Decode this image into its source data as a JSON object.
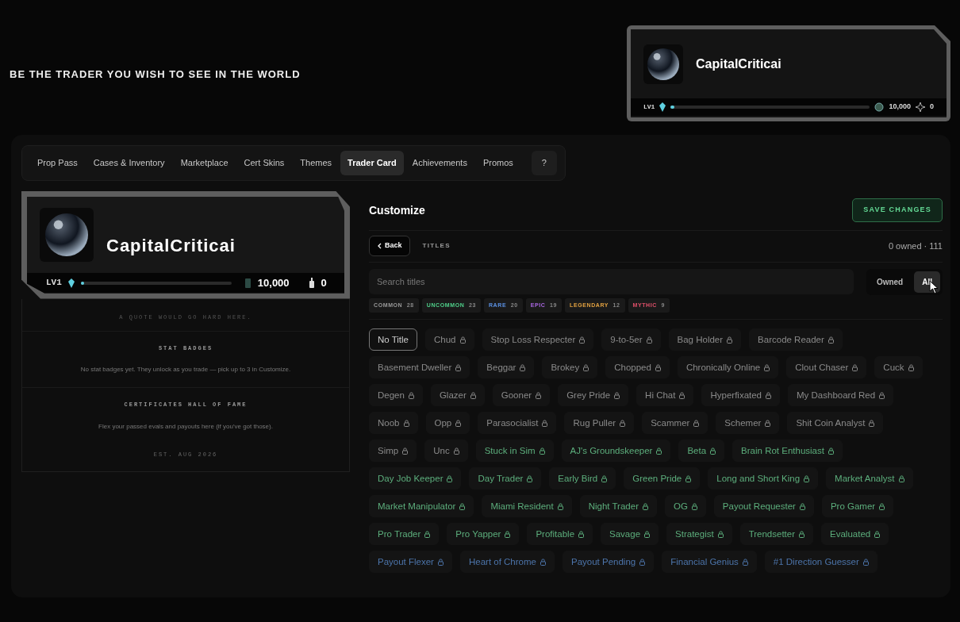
{
  "tagline": "BE THE TRADER YOU WISH TO SEE IN THE WORLD",
  "mini_card": {
    "username": "CapitalCriticai",
    "level_label": "LV1",
    "level": 0.02,
    "coins": "10,000",
    "stars": "0"
  },
  "tabs": [
    {
      "label": "Prop Pass",
      "selected": false
    },
    {
      "label": "Cases & Inventory",
      "selected": false
    },
    {
      "label": "Marketplace",
      "selected": false
    },
    {
      "label": "Cert Skins",
      "selected": false
    },
    {
      "label": "Themes",
      "selected": false
    },
    {
      "label": "Trader Card",
      "selected": true
    },
    {
      "label": "Achievements",
      "selected": false
    },
    {
      "label": "Promos",
      "selected": false
    },
    {
      "label": "?",
      "selected": false
    }
  ],
  "trader_card": {
    "username": "CapitalCriticai",
    "level_label": "LV1",
    "level": 0.02,
    "coins": "10,000",
    "badges": "0",
    "quote": "A QUOTE WOULD GO HARD HERE.",
    "stat_badges_heading": "STAT BADGES",
    "stat_badges_text": "No stat badges yet. They unlock as you trade — pick up to 3 in Customize.",
    "certificates_heading": "CERTIFICATES HALL OF FAME",
    "certificates_text": "Flex your passed evals and payouts here (if you've got those).",
    "established": "EST. AUG 2026"
  },
  "customize": {
    "title": "Customize",
    "save_button": "SAVE CHANGES",
    "back_button": "Back",
    "section": "TITLES",
    "count": "0 owned · 111",
    "search": {
      "placeholder": "Search titles"
    },
    "filter": [
      {
        "label": "Owned",
        "selected": false
      },
      {
        "label": "All",
        "selected": true
      }
    ],
    "rarities": [
      {
        "label": "COMMON",
        "count": "28",
        "color": "#9a9a9a"
      },
      {
        "label": "UNCOMMON",
        "count": "23",
        "color": "#4fd08a"
      },
      {
        "label": "RARE",
        "count": "20",
        "color": "#5a8fe0"
      },
      {
        "label": "EPIC",
        "count": "19",
        "color": "#a865e0"
      },
      {
        "label": "LEGENDARY",
        "count": "12",
        "color": "#e0a040"
      },
      {
        "label": "MYTHIC",
        "count": "9",
        "color": "#e0506a"
      }
    ],
    "titles": [
      {
        "label": "No Title",
        "kind": "none",
        "locked": false,
        "selected": true
      },
      {
        "label": "Chud",
        "kind": "common",
        "locked": true,
        "selected": false
      },
      {
        "label": "Stop Loss Respecter",
        "kind": "common",
        "locked": true,
        "selected": false
      },
      {
        "label": "9-to-5er",
        "kind": "common",
        "locked": true,
        "selected": false
      },
      {
        "label": "Bag Holder",
        "kind": "common",
        "locked": true,
        "selected": false
      },
      {
        "label": "Barcode Reader",
        "kind": "common",
        "locked": true,
        "selected": false
      },
      {
        "label": "Basement Dweller",
        "kind": "common",
        "locked": true,
        "selected": false
      },
      {
        "label": "Beggar",
        "kind": "common",
        "locked": true,
        "selected": false
      },
      {
        "label": "Brokey",
        "kind": "common",
        "locked": true,
        "selected": false
      },
      {
        "label": "Chopped",
        "kind": "common",
        "locked": true,
        "selected": false
      },
      {
        "label": "Chronically Online",
        "kind": "common",
        "locked": true,
        "selected": false
      },
      {
        "label": "Clout Chaser",
        "kind": "common",
        "locked": true,
        "selected": false
      },
      {
        "label": "Cuck",
        "kind": "common",
        "locked": true,
        "selected": false
      },
      {
        "label": "Degen",
        "kind": "common",
        "locked": true,
        "selected": false
      },
      {
        "label": "Glazer",
        "kind": "common",
        "locked": true,
        "selected": false
      },
      {
        "label": "Gooner",
        "kind": "common",
        "locked": true,
        "selected": false
      },
      {
        "label": "Grey Pride",
        "kind": "common",
        "locked": true,
        "selected": false
      },
      {
        "label": "Hi Chat",
        "kind": "common",
        "locked": true,
        "selected": false
      },
      {
        "label": "Hyperfixated",
        "kind": "common",
        "locked": true,
        "selected": false
      },
      {
        "label": "My Dashboard Red",
        "kind": "common",
        "locked": true,
        "selected": false
      },
      {
        "label": "Noob",
        "kind": "common",
        "locked": true,
        "selected": false
      },
      {
        "label": "Opp",
        "kind": "common",
        "locked": true,
        "selected": false
      },
      {
        "label": "Parasocialist",
        "kind": "common",
        "locked": true,
        "selected": false
      },
      {
        "label": "Rug Puller",
        "kind": "common",
        "locked": true,
        "selected": false
      },
      {
        "label": "Scammer",
        "kind": "common",
        "locked": true,
        "selected": false
      },
      {
        "label": "Schemer",
        "kind": "common",
        "locked": true,
        "selected": false
      },
      {
        "label": "Shit Coin Analyst",
        "kind": "common",
        "locked": true,
        "selected": false
      },
      {
        "label": "Simp",
        "kind": "common",
        "locked": true,
        "selected": false
      },
      {
        "label": "Unc",
        "kind": "common",
        "locked": true,
        "selected": false
      },
      {
        "label": "Stuck in Sim",
        "kind": "uncommon",
        "locked": true,
        "selected": false
      },
      {
        "label": "AJ's Groundskeeper",
        "kind": "uncommon",
        "locked": true,
        "selected": false
      },
      {
        "label": "Beta",
        "kind": "uncommon",
        "locked": true,
        "selected": false
      },
      {
        "label": "Brain Rot Enthusiast",
        "kind": "uncommon",
        "locked": true,
        "selected": false
      },
      {
        "label": "Day Job Keeper",
        "kind": "uncommon",
        "locked": true,
        "selected": false
      },
      {
        "label": "Day Trader",
        "kind": "uncommon",
        "locked": true,
        "selected": false
      },
      {
        "label": "Early Bird",
        "kind": "uncommon",
        "locked": true,
        "selected": false
      },
      {
        "label": "Green Pride",
        "kind": "uncommon",
        "locked": true,
        "selected": false
      },
      {
        "label": "Long and Short King",
        "kind": "uncommon",
        "locked": true,
        "selected": false
      },
      {
        "label": "Market Analyst",
        "kind": "uncommon",
        "locked": true,
        "selected": false
      },
      {
        "label": "Market Manipulator",
        "kind": "uncommon",
        "locked": true,
        "selected": false
      },
      {
        "label": "Miami Resident",
        "kind": "uncommon",
        "locked": true,
        "selected": false
      },
      {
        "label": "Night Trader",
        "kind": "uncommon",
        "locked": true,
        "selected": false
      },
      {
        "label": "OG",
        "kind": "uncommon",
        "locked": true,
        "selected": false
      },
      {
        "label": "Payout Requester",
        "kind": "uncommon",
        "locked": true,
        "selected": false
      },
      {
        "label": "Pro Gamer",
        "kind": "uncommon",
        "locked": true,
        "selected": false
      },
      {
        "label": "Pro Trader",
        "kind": "uncommon",
        "locked": true,
        "selected": false
      },
      {
        "label": "Pro Yapper",
        "kind": "uncommon",
        "locked": true,
        "selected": false
      },
      {
        "label": "Profitable",
        "kind": "uncommon",
        "locked": true,
        "selected": false
      },
      {
        "label": "Savage",
        "kind": "uncommon",
        "locked": true,
        "selected": false
      },
      {
        "label": "Strategist",
        "kind": "uncommon",
        "locked": true,
        "selected": false
      },
      {
        "label": "Trendsetter",
        "kind": "uncommon",
        "locked": true,
        "selected": false
      },
      {
        "label": "Evaluated",
        "kind": "uncommon",
        "locked": true,
        "selected": false
      },
      {
        "label": "Payout Flexer",
        "kind": "rare",
        "locked": true,
        "selected": false
      },
      {
        "label": "Heart of Chrome",
        "kind": "rare",
        "locked": true,
        "selected": false
      },
      {
        "label": "Payout Pending",
        "kind": "rare",
        "locked": true,
        "selected": false
      },
      {
        "label": "Financial Genius",
        "kind": "rare",
        "locked": true,
        "selected": false
      },
      {
        "label": "#1 Direction Guesser",
        "kind": "rare",
        "locked": true,
        "selected": false
      }
    ]
  }
}
